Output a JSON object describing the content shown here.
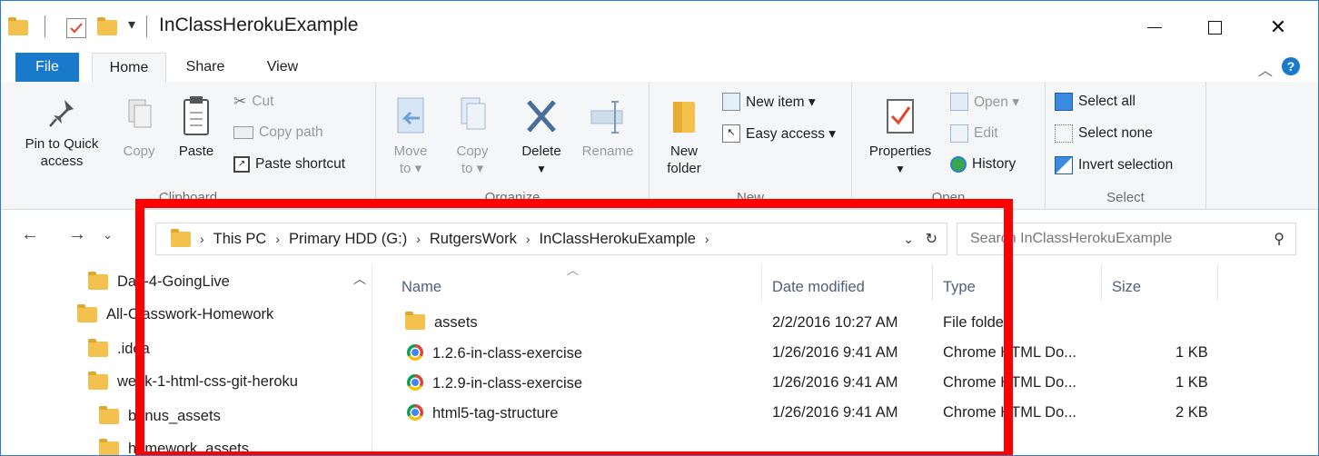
{
  "window": {
    "title": "InClassHerokuExample",
    "accent": "#1979ca"
  },
  "tabs": [
    {
      "label": "File"
    },
    {
      "label": "Home"
    },
    {
      "label": "Share"
    },
    {
      "label": "View"
    }
  ],
  "ribbon": {
    "clipboard": {
      "label": "Clipboard",
      "pin_line1": "Pin to Quick",
      "pin_line2": "access",
      "copy": "Copy",
      "paste": "Paste",
      "cut": "Cut",
      "copy_path": "Copy path",
      "paste_shortcut": "Paste shortcut"
    },
    "organize": {
      "label": "Organize",
      "move_line1": "Move",
      "move_line2": "to ▾",
      "copy_line1": "Copy",
      "copy_line2": "to ▾",
      "delete": "Delete",
      "rename": "Rename"
    },
    "new": {
      "label": "New",
      "new_folder_line1": "New",
      "new_folder_line2": "folder",
      "new_item": "New item ▾",
      "easy_access": "Easy access ▾"
    },
    "open": {
      "label": "Open",
      "properties": "Properties",
      "open": "Open ▾",
      "edit": "Edit",
      "history": "History"
    },
    "select": {
      "label": "Select",
      "select_all": "Select all",
      "select_none": "Select none",
      "invert_selection": "Invert selection"
    }
  },
  "address": {
    "breadcrumbs": [
      "This PC",
      "Primary HDD (G:)",
      "RutgersWork",
      "InClassHerokuExample"
    ],
    "search_placeholder": "Search InClassHerokuExample"
  },
  "nav_tree": [
    {
      "label": "Day-4-GoingLive"
    },
    {
      "label": "All-Classwork-Homework"
    },
    {
      "label": ".idea"
    },
    {
      "label": "week-1-html-css-git-heroku"
    },
    {
      "label": "bonus_assets"
    },
    {
      "label": "homework_assets"
    }
  ],
  "file_list": {
    "columns": [
      "Name",
      "Date modified",
      "Type",
      "Size"
    ],
    "rows": [
      {
        "name": "assets",
        "date": "2/2/2016 10:27 AM",
        "type": "File folder",
        "size": "",
        "icon": "folder-icon"
      },
      {
        "name": "1.2.6-in-class-exercise",
        "date": "1/26/2016 9:41 AM",
        "type": "Chrome HTML Do...",
        "size": "1 KB",
        "icon": "chrome-icon"
      },
      {
        "name": "1.2.9-in-class-exercise",
        "date": "1/26/2016 9:41 AM",
        "type": "Chrome HTML Do...",
        "size": "1 KB",
        "icon": "chrome-icon"
      },
      {
        "name": "html5-tag-structure",
        "date": "1/26/2016 9:41 AM",
        "type": "Chrome HTML Do...",
        "size": "2 KB",
        "icon": "chrome-icon"
      }
    ]
  },
  "annotation": {
    "color": "#ff0000"
  }
}
